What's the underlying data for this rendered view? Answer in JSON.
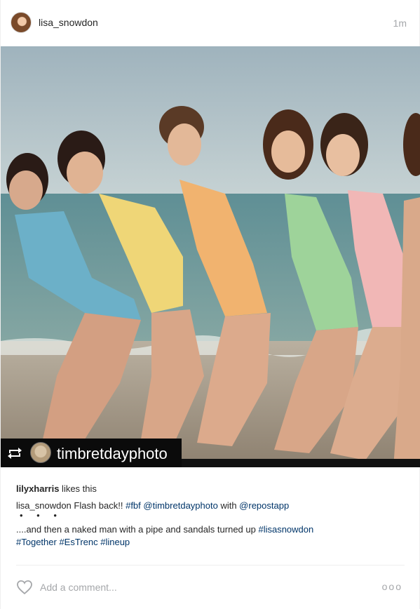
{
  "post": {
    "username": "lisa_snowdon",
    "timestamp": "1m",
    "avatar_icon": "profile-avatar",
    "image_alt": "five women in one-piece swimsuits lined up on a beach",
    "repost": {
      "icon": "repost-icon",
      "username": "timbretdayphoto"
    },
    "likes": {
      "user": "lilyxharris",
      "text": " likes this"
    },
    "caption": {
      "author": "lisa_snowdon",
      "part1": " Flash back!! ",
      "tag1": "#fbf",
      "space1": " ",
      "mention1": "@timbretdayphoto",
      "with": " with ",
      "mention2": "@repostapp",
      "dots": "• • •",
      "line3": "....and then a naked man with a pipe and sandals turned up ",
      "tag2": "#lisasnowdon",
      "tag3": "#Together",
      "tag4": "#EsTrenc",
      "tag5": "#lineup"
    },
    "comment": {
      "placeholder": "Add a comment...",
      "like_icon": "heart-icon",
      "more_icon": "more-options-icon",
      "more_text": "ooo"
    }
  },
  "colors": {
    "link": "#003569",
    "muted": "#a5a7aa",
    "text": "#262626",
    "divider": "#efefef"
  }
}
